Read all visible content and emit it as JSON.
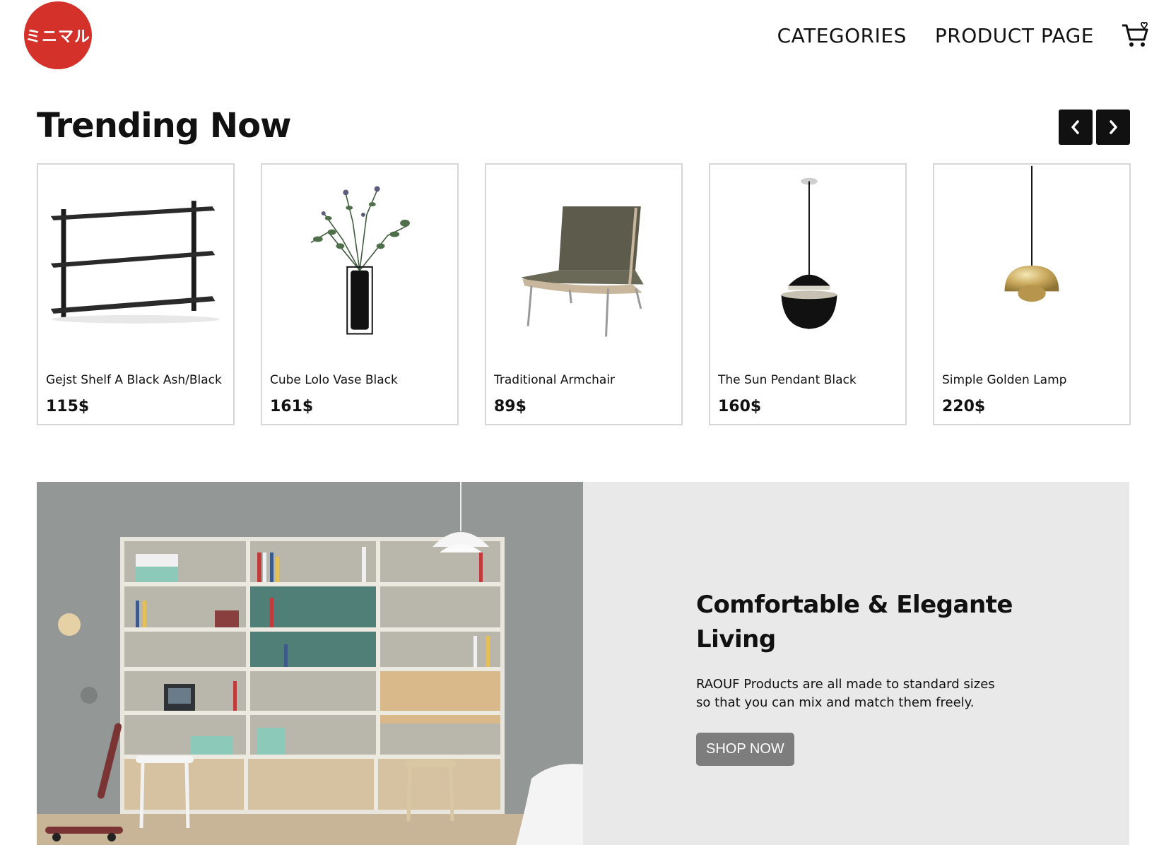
{
  "header": {
    "logo_text": "ミニマル",
    "nav": [
      {
        "label": "CATEGORIES"
      },
      {
        "label": "PRODUCT PAGE"
      }
    ],
    "cart_icon": "cart-icon"
  },
  "trending": {
    "title": "Trending Now",
    "prev_icon": "chevron-left-icon",
    "next_icon": "chevron-right-icon",
    "products": [
      {
        "name": "Gejst Shelf A Black Ash/Black",
        "price": "115$",
        "image": "shelf"
      },
      {
        "name": "Cube Lolo Vase Black",
        "price": "161$",
        "image": "vase"
      },
      {
        "name": "Traditional Armchair",
        "price": "89$",
        "image": "armchair"
      },
      {
        "name": "The Sun Pendant Black",
        "price": "160$",
        "image": "pendant-lamp"
      },
      {
        "name": "Simple Golden Lamp",
        "price": "220$",
        "image": "golden-lamp"
      }
    ]
  },
  "banner": {
    "title": "Comfortable & Elegante Living",
    "description": "RAOUF Products are all made to standard sizes so that you can mix and match them freely.",
    "button": "SHOP NOW"
  },
  "colors": {
    "brand": "#d3312a",
    "button": "#7d7d7d",
    "banner_bg": "#e9e9e9",
    "card_border": "#d7d7d7"
  }
}
